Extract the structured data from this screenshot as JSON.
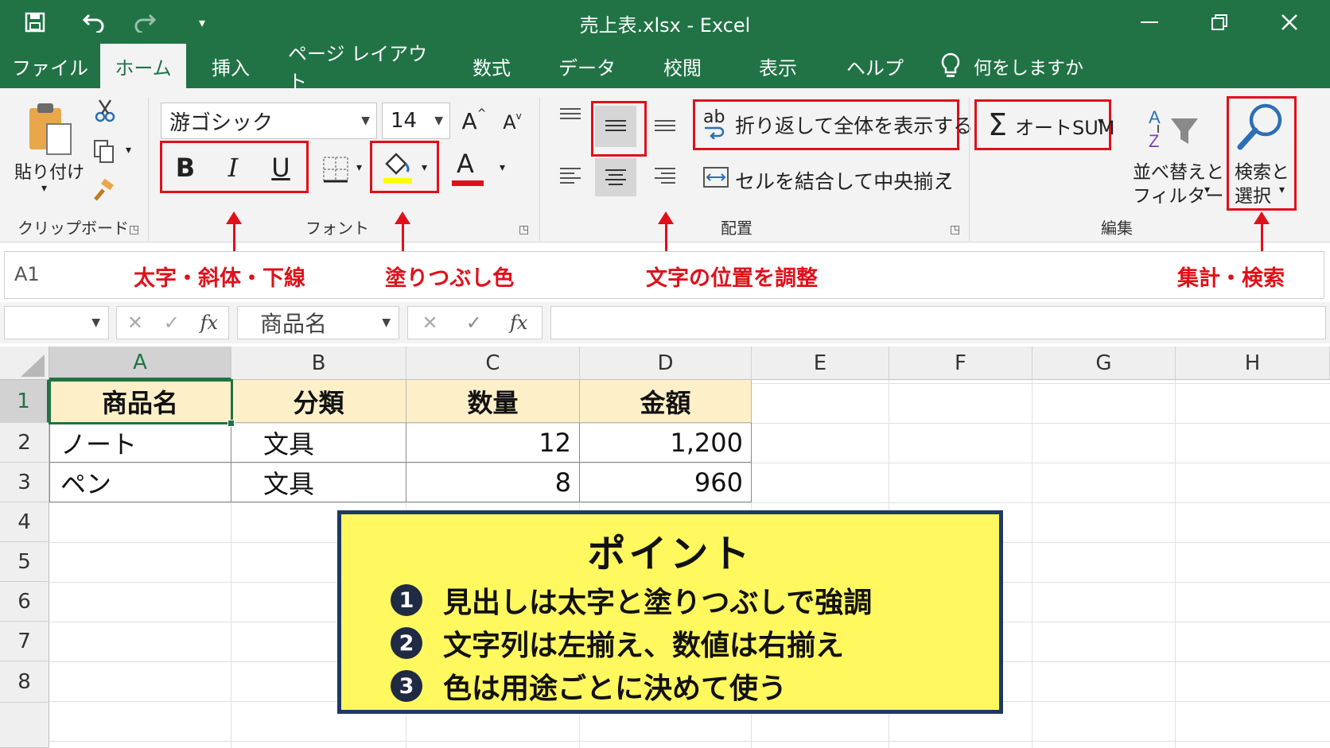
{
  "window": {
    "title": "売上表.xlsx  -  Excel"
  },
  "tabs": [
    "ファイル",
    "ホーム",
    "挿入",
    "ページ レイアウト",
    "数式",
    "データ",
    "校閲",
    "表示",
    "ヘルプ"
  ],
  "tell_me": "何をしますか",
  "ribbon": {
    "clipboard": {
      "paste_label": "貼り付け",
      "group_label": "クリップボード"
    },
    "font": {
      "font_name": "游ゴシック",
      "font_size": "14",
      "bold": "B",
      "italic": "I",
      "underline": "U",
      "font_color_glyph": "A",
      "grow_glyph": "A",
      "shrink_glyph": "A",
      "group_label": "フォント",
      "fill_color": "#ffff00",
      "font_color": "#e0101a"
    },
    "alignment": {
      "wrap_text": "折り返して全体を表示する",
      "merge_center": "セルを結合して中央揃え",
      "group_label": "配置",
      "wrap_icon_text": "ab"
    },
    "editing": {
      "autosum": "オートSUM",
      "sort_filter_line1": "並べ替えと",
      "sort_filter_line2": "フィルター",
      "find_select_line1": "検索と",
      "find_select_line2": "選択",
      "group_label": "編集"
    }
  },
  "annotations": {
    "font_styles": "太字・斜体・下線",
    "fill_color": "塗りつぶし色",
    "alignment": "文字の位置を調整",
    "editing": "集計・検索",
    "accent_color": "#e0101a"
  },
  "formula_bar": {
    "name_box": "A1",
    "cell_value": "商品名",
    "fx": "fx"
  },
  "sheet": {
    "columns": [
      "A",
      "B",
      "C",
      "D",
      "E",
      "F",
      "G",
      "H"
    ],
    "rows": [
      "1",
      "2",
      "3",
      "4",
      "5",
      "6",
      "7",
      "8"
    ],
    "header": [
      "商品名",
      "分類",
      "数量",
      "金額"
    ],
    "data": [
      [
        "ノート",
        "文具",
        "12",
        "1,200"
      ],
      [
        "ペン",
        "文具",
        "8",
        "960"
      ]
    ]
  },
  "point": {
    "title": "ポイント",
    "items": [
      {
        "num": "1",
        "text": "見出しは太字と塗りつぶしで強調"
      },
      {
        "num": "2",
        "text": "文字列は左揃え、数値は右揃え"
      },
      {
        "num": "3",
        "text": "色は用途ごとに決めて使う"
      }
    ]
  },
  "colors": {
    "excel_green": "#217346",
    "header_fill": "#fdf0c8",
    "point_fill": "#fff85e",
    "point_border": "#1f3864"
  }
}
